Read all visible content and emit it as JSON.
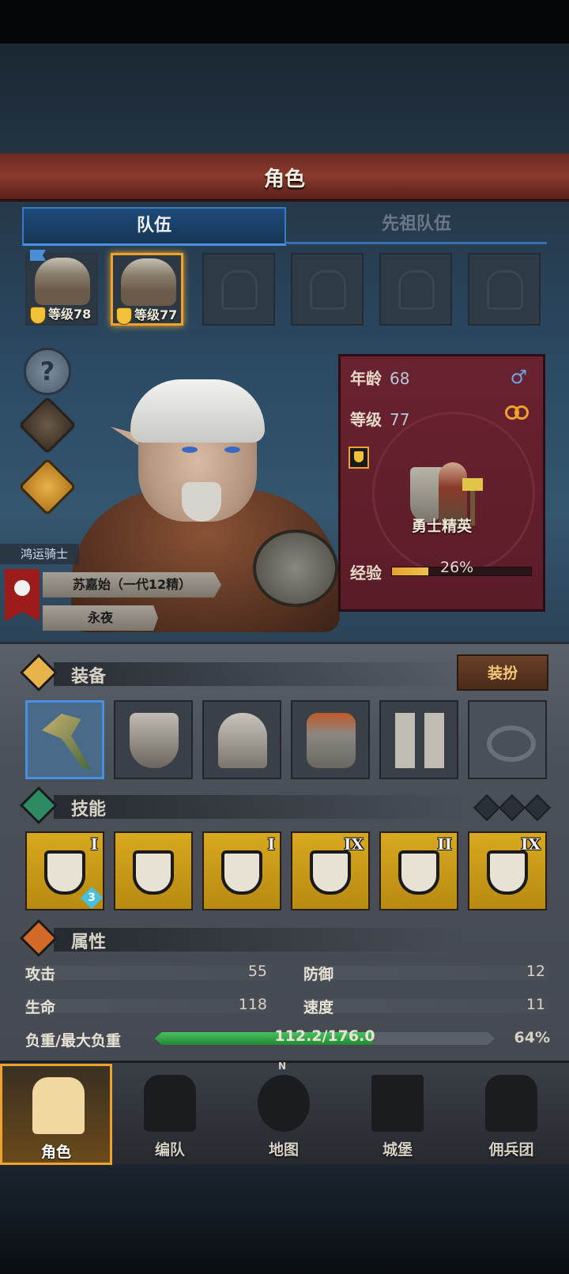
{
  "header": {
    "title": "角色"
  },
  "tabs": [
    {
      "label": "队伍",
      "active": true
    },
    {
      "label": "先祖队伍",
      "active": false
    }
  ],
  "party": [
    {
      "level_label": "等级78",
      "selected": false,
      "flag": true
    },
    {
      "level_label": "等级77",
      "selected": true,
      "flag": false
    },
    {
      "empty": true
    },
    {
      "empty": true
    },
    {
      "empty": true
    },
    {
      "empty": true
    }
  ],
  "side_buttons": [
    {
      "icon": "help-icon",
      "glyph": "?"
    },
    {
      "icon": "character-icon"
    },
    {
      "icon": "potion-icon"
    }
  ],
  "info": {
    "age_label": "年龄",
    "age_value": "68",
    "gender": "♂",
    "level_label": "等级",
    "level_value": "77",
    "class_name": "勇士精英",
    "exp_label": "经验",
    "exp_percent": "26%",
    "exp_fraction": 0.26
  },
  "hero_tags": {
    "title": "鸿运骑士",
    "name": "苏嘉始（一代12精）",
    "trait": "永夜"
  },
  "equipment": {
    "section_label": "装备",
    "dress_button": "装扮",
    "slots": [
      "hammer-icon",
      "chest-armor-icon",
      "helmet-icon",
      "cloak-armor-icon",
      "boots-icon",
      "ring-slot-icon"
    ]
  },
  "skills": {
    "section_label": "技能",
    "items": [
      {
        "rank": "I",
        "badge": "3"
      },
      {
        "rank": ""
      },
      {
        "rank": "I"
      },
      {
        "rank": "IX"
      },
      {
        "rank": "II"
      },
      {
        "rank": "IX"
      }
    ]
  },
  "attributes": {
    "section_label": "属性",
    "attack_label": "攻击",
    "attack_value": "55",
    "defense_label": "防御",
    "defense_value": "12",
    "hp_label": "生命",
    "hp_value": "118",
    "speed_label": "速度",
    "speed_value": "11",
    "load_label": "负重/最大负重",
    "load_text": "112.2/176.0",
    "load_percent": "64%",
    "load_fraction": 0.64
  },
  "nav": [
    {
      "label": "角色",
      "active": true
    },
    {
      "label": "编队",
      "active": false
    },
    {
      "label": "地图",
      "active": false,
      "compass": "N"
    },
    {
      "label": "城堡",
      "active": false
    },
    {
      "label": "佣兵团",
      "active": false
    }
  ],
  "colors": {
    "accent": "#f1a22a",
    "title_bar": "#8a3a2c",
    "tab_active": "#1e4a7a",
    "skill_bg": "#d8a820",
    "load_fill": "#2fa044"
  }
}
